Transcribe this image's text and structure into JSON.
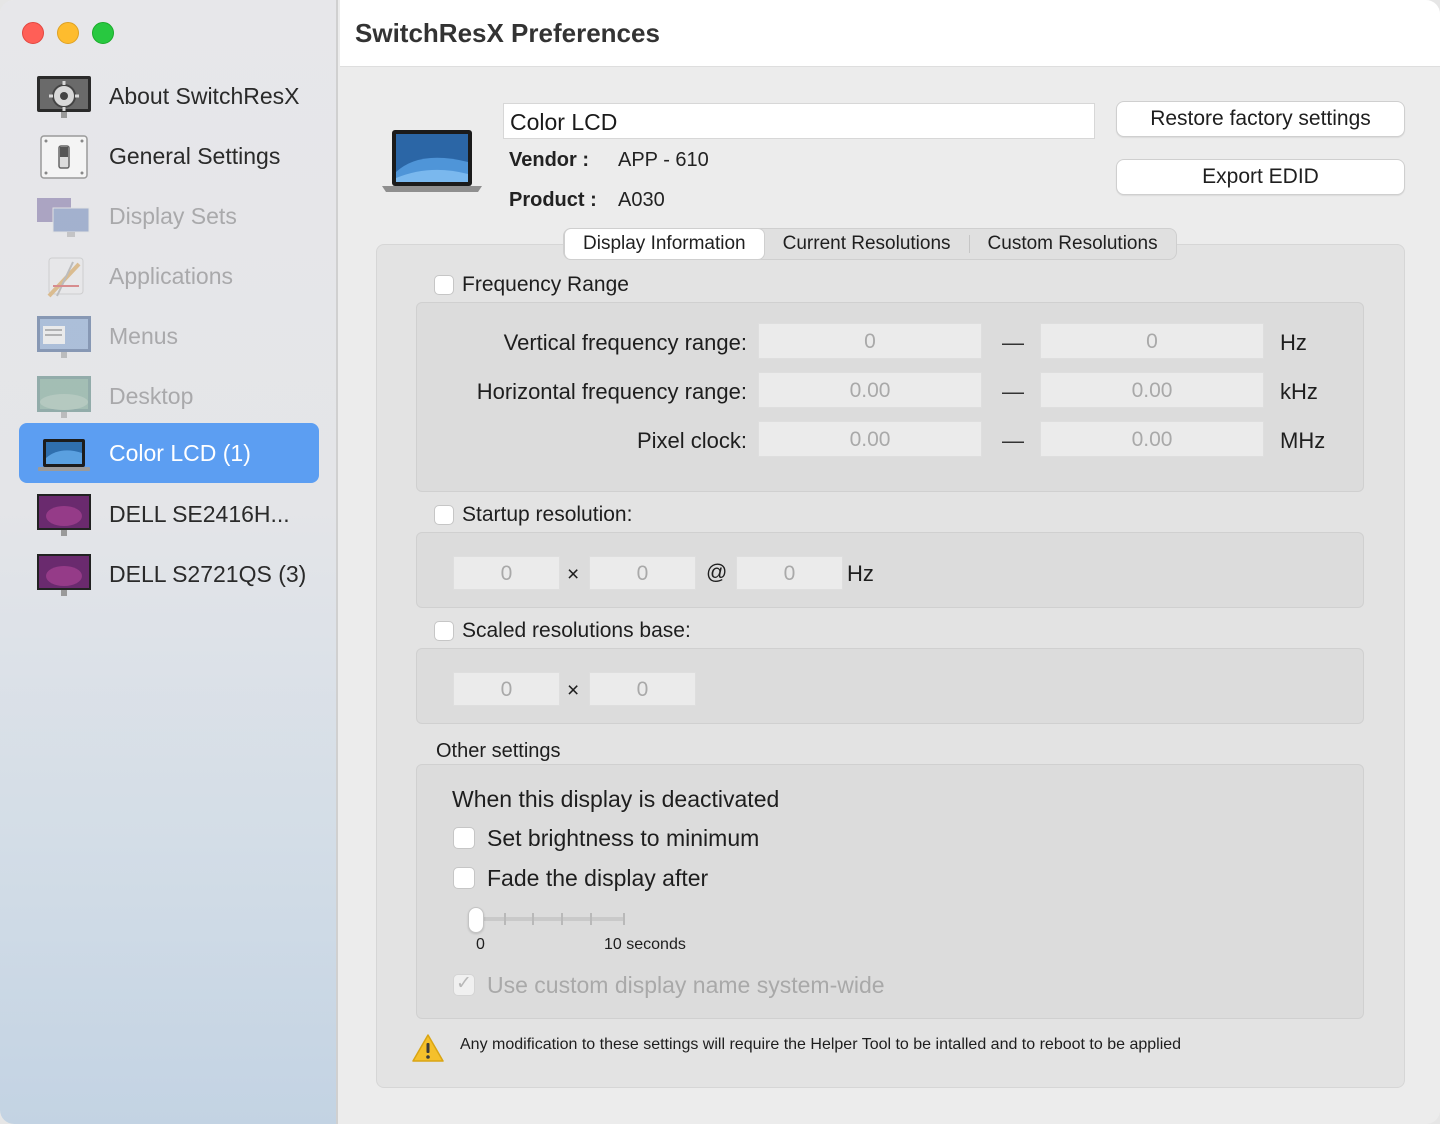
{
  "window": {
    "title": "SwitchResX Preferences"
  },
  "sidebar": {
    "items": [
      {
        "label": "About SwitchResX",
        "icon": "gear-monitor-icon",
        "state": "normal"
      },
      {
        "label": "General Settings",
        "icon": "switch-icon",
        "state": "normal"
      },
      {
        "label": "Display Sets",
        "icon": "display-sets-icon",
        "state": "disabled"
      },
      {
        "label": "Applications",
        "icon": "applications-icon",
        "state": "disabled"
      },
      {
        "label": "Menus",
        "icon": "menus-icon",
        "state": "disabled"
      },
      {
        "label": "Desktop",
        "icon": "desktop-icon",
        "state": "disabled"
      },
      {
        "label": "Color LCD (1)",
        "icon": "laptop-icon",
        "state": "selected"
      },
      {
        "label": "DELL SE2416H...",
        "icon": "monitor-icon",
        "state": "normal"
      },
      {
        "label": "DELL S2721QS (3)",
        "icon": "monitor-icon",
        "state": "normal"
      }
    ]
  },
  "display": {
    "name": "Color LCD",
    "vendor_label": "Vendor :",
    "vendor": "APP - 610",
    "product_label": "Product :",
    "product": "A030"
  },
  "buttons": {
    "restore": "Restore factory settings",
    "export": "Export EDID"
  },
  "tabs": [
    "Display Information",
    "Current Resolutions",
    "Custom Resolutions"
  ],
  "frequency": {
    "checkbox_label": "Frequency Range",
    "rows": [
      {
        "label": "Vertical frequency range:",
        "min": "0",
        "max": "0",
        "unit": "Hz"
      },
      {
        "label": "Horizontal frequency range:",
        "min": "0.00",
        "max": "0.00",
        "unit": "kHz"
      },
      {
        "label": "Pixel clock:",
        "min": "0.00",
        "max": "0.00",
        "unit": "MHz"
      }
    ],
    "dash": "—"
  },
  "startup": {
    "checkbox_label": "Startup resolution:",
    "width": "0",
    "height": "0",
    "refresh": "0",
    "times": "×",
    "at": "@",
    "unit": "Hz"
  },
  "scaled": {
    "checkbox_label": "Scaled resolutions base:",
    "width": "0",
    "height": "0",
    "times": "×"
  },
  "other": {
    "title": "Other settings",
    "deactivated_heading": "When this display is deactivated",
    "brightness_label": "Set brightness to minimum",
    "fade_label": "Fade the display after",
    "slider_min_label": "0",
    "slider_max_label": "10 seconds",
    "slider_value": 0,
    "custom_name_label": "Use custom display name system-wide"
  },
  "warning": {
    "text": "Any modification to these settings will require the Helper Tool to be intalled and to reboot to be applied"
  }
}
